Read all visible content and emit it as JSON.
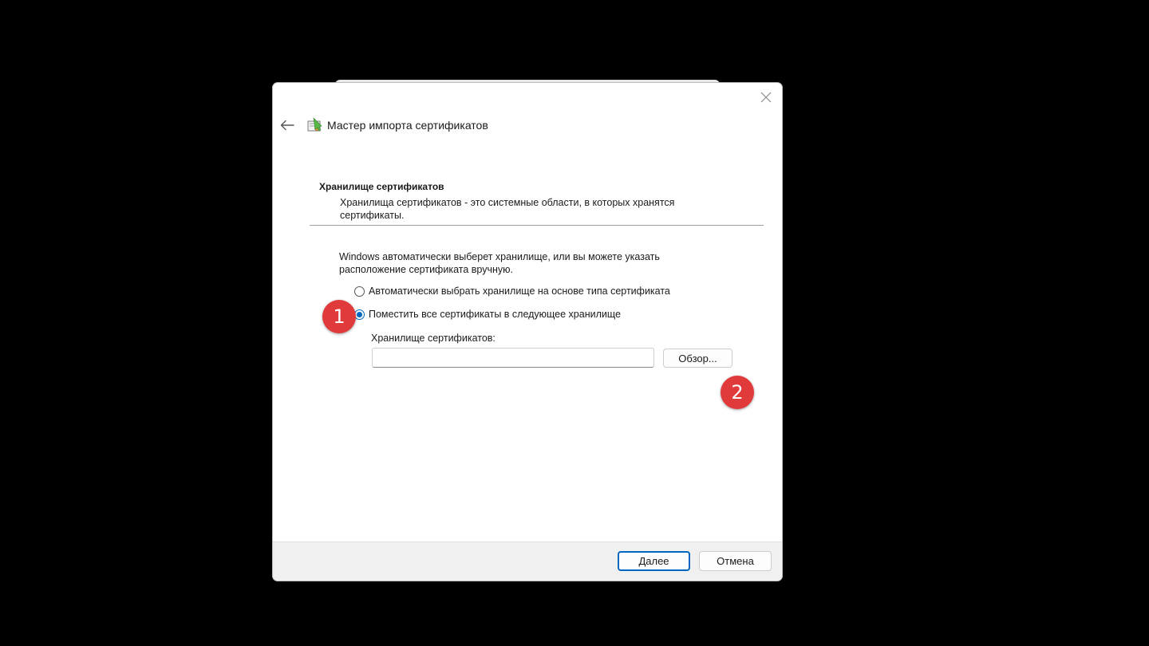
{
  "wizard": {
    "title": "Мастер импорта сертификатов",
    "icon": "certificate-wizard-icon",
    "back_icon": "back-arrow-icon",
    "close_icon": "close-icon"
  },
  "section": {
    "header": "Хранилище сертификатов",
    "description": "Хранилища сертификатов - это системные области, в которых хранятся сертификаты."
  },
  "intro": "Windows автоматически выберет хранилище, или вы можете указать расположение сертификата вручную.",
  "options": {
    "auto_label": "Автоматически выбрать хранилище на основе типа сертификата",
    "manual_label": "Поместить все сертификаты в следующее хранилище",
    "selected": "manual"
  },
  "store": {
    "label": "Хранилище сертификатов:",
    "value": "",
    "browse_label": "Обзор..."
  },
  "footer": {
    "next_label": "Далее",
    "cancel_label": "Отмена"
  },
  "annotations": {
    "step1": "1",
    "step2": "2"
  },
  "colors": {
    "accent": "#0067c0",
    "badge": "#e03a3a",
    "background": "#000000"
  }
}
